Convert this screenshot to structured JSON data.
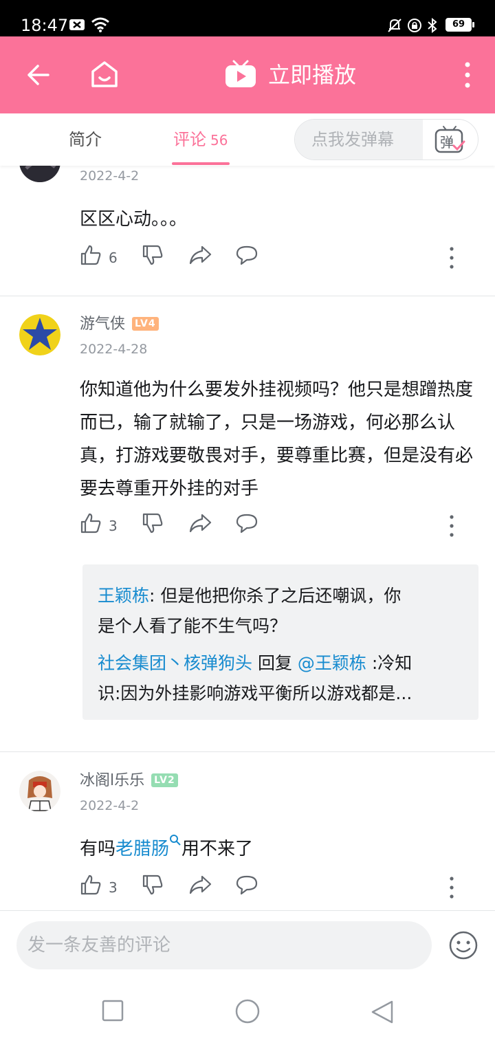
{
  "status_bar": {
    "time": "18:47",
    "battery": "69"
  },
  "app_bar": {
    "title": "立即播放"
  },
  "tabs": {
    "intro_label": "简介",
    "comments_label": "评论",
    "comments_count": "56",
    "danmaku_placeholder": "点我发弹幕",
    "danmaku_button_label": "弹"
  },
  "comments": [
    {
      "date": "2022-4-2",
      "text": "区区心动。。。",
      "likes": "6"
    },
    {
      "username": "游气侠",
      "level": "LV4",
      "date": "2022-4-28",
      "text": "你知道他为什么要发外挂视频吗？他只是想蹭热度而已，输了就输了，只是一场游戏，何必那么认真，打游戏要敬畏对手，要尊重比赛，但是没有必要去尊重开外挂的对手",
      "likes": "3",
      "replies": [
        {
          "author": "王颖栋",
          "separator": ": ",
          "line1": "但是他把你杀了之后还嘲讽，你",
          "line2": "是个人看了能不生气吗？"
        },
        {
          "author": "社会集团丶核弹狗头",
          "reply_word": " 回复 ",
          "mention": "@王颖栋",
          "line1": " :冷知",
          "line2": "识:因为外挂影响游戏平衡所以游戏都是..."
        }
      ]
    },
    {
      "username": "冰阁l乐乐",
      "level": "LV2",
      "date": "2022-4-2",
      "text_before": "有吗",
      "text_link": "老腊肠",
      "text_after": "用不来了",
      "likes": "3"
    }
  ],
  "bottom_bar": {
    "placeholder": "发一条友善的评论"
  },
  "colors": {
    "brand": "#fb7299",
    "link": "#178bcf",
    "lv4": "#ffb37c",
    "lv2": "#95ddb2"
  }
}
